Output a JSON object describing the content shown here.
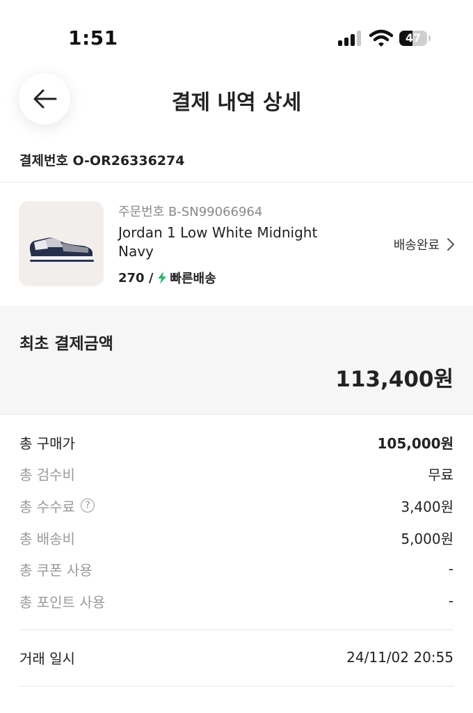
{
  "status_bar": {
    "time": "1:51",
    "battery": "47",
    "battery_level": 0.47
  },
  "header": {
    "title": "결제 내역 상세"
  },
  "payment": {
    "number": "결제번호 O-OR26336274"
  },
  "product": {
    "order_number": "주문번호 B-SN99066964",
    "name": "Jordan 1 Low White Midnight Navy",
    "size": "270 /",
    "delivery_type": "빠른배송",
    "status": "배송완료",
    "accent_color": "#31b46e"
  },
  "total": {
    "label": "최초 결제금액",
    "value": "113,400원"
  },
  "breakdown": [
    {
      "label": "총 구매가",
      "value": "105,000원"
    },
    {
      "label": "총 검수비",
      "value": "무료"
    },
    {
      "label": "총 수수료",
      "value": "3,400원",
      "help_icon": "?"
    },
    {
      "label": "총 배송비",
      "value": "5,000원"
    },
    {
      "label": "총 쿠폰 사용",
      "value": "-"
    },
    {
      "label": "총 포인트 사용",
      "value": "-"
    }
  ],
  "transaction": {
    "label": "거래 일시",
    "value": "24/11/02 20:55"
  }
}
